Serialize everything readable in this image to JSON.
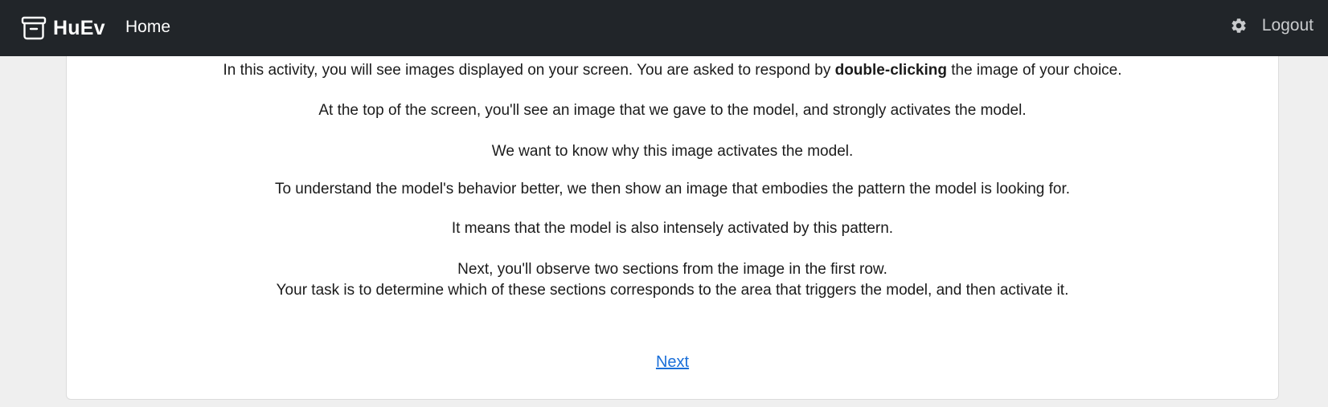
{
  "navbar": {
    "brand": "HuEv",
    "home": "Home",
    "logout": "Logout",
    "icons": {
      "brand": "archive-box-icon",
      "settings": "gear-icon"
    },
    "colors": {
      "background": "#212529",
      "text": "#ffffff"
    }
  },
  "instructions": {
    "p1_before": "In this activity, you will see images displayed on your screen. You are asked to respond by ",
    "p1_bold": "double-clicking",
    "p1_after": " the image of your choice.",
    "p2": "At the top of the screen, you'll see an image that we gave to the model, and strongly activates the model.",
    "p3": "We want to know why this image activates the model.",
    "p4": "To understand the model's behavior better, we then show an image that embodies the pattern the model is looking for.",
    "p5": "It means that the model is also intensely activated by this pattern.",
    "p6_line1": "Next, you'll observe two sections from the image in the first row.",
    "p6_line2": "Your task is to determine which of these sections corresponds to the area that triggers the model, and then activate it."
  },
  "next_label": "Next",
  "colors": {
    "link": "#1a6fd9",
    "page_background": "#efefef",
    "card_background": "#ffffff"
  }
}
